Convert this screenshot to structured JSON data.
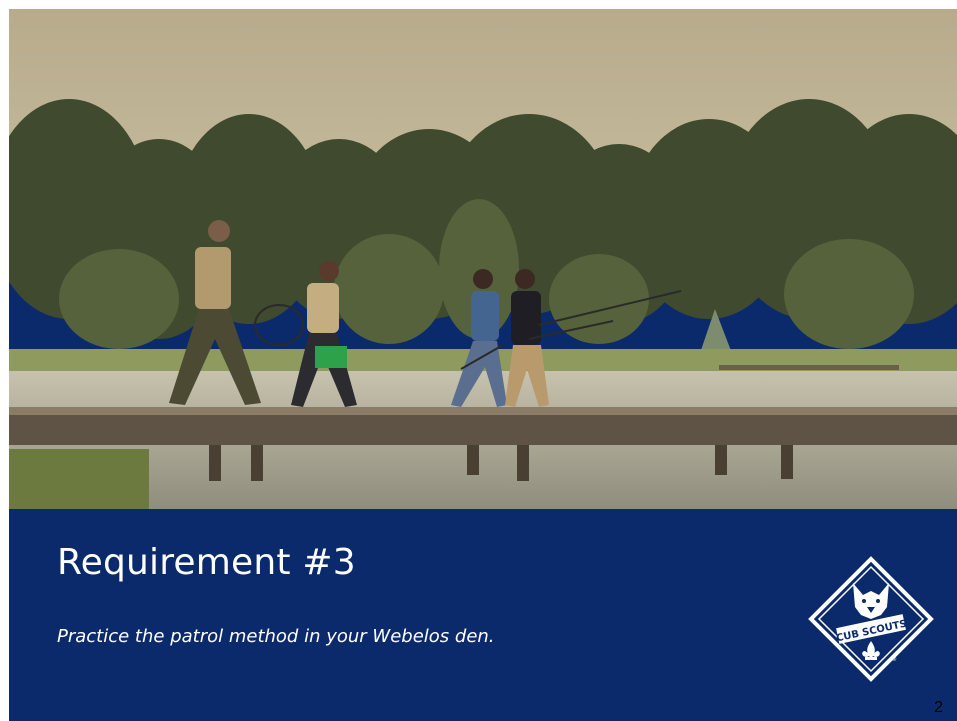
{
  "slide": {
    "title": "Requirement #3",
    "subtitle": "Practice the patrol method in your Webelos den.",
    "page_number": "2",
    "banner_color": "#0b2a6b"
  },
  "photo": {
    "description_icon": "photo-scouts-walking-on-pier"
  },
  "logo": {
    "name": "cub-scouts-logo",
    "text": "CUB SCOUTS",
    "color": "#ffffff"
  }
}
